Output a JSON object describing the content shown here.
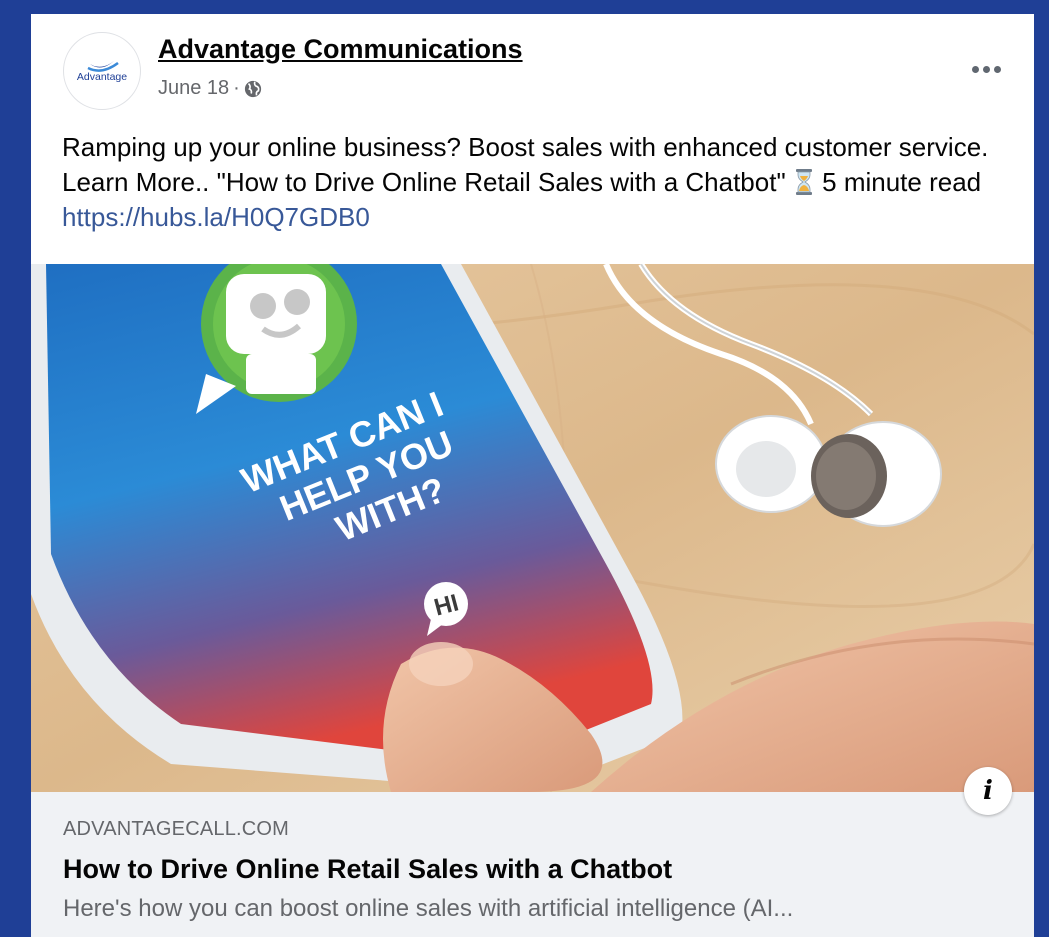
{
  "post": {
    "page_name": "Advantage Communications",
    "date": "June 18",
    "separator": "·",
    "avatar_text": "Advantage",
    "icons": {
      "audience": "globe-icon",
      "more": "more-options-icon",
      "hourglass": "hourglass-icon",
      "info": "info-icon"
    },
    "text_before": "Ramping up your online business? Boost sales with enhanced customer service. Learn More.. \"How to Drive Online Retail Sales with a Chatbot\" ",
    "text_after": " 5 minute read ",
    "link": "https://hubs.la/H0Q7GDB0"
  },
  "image": {
    "bubble_line1": "WHAT CAN I",
    "bubble_line2": "HELP YOU",
    "bubble_line3": "WITH?",
    "hi_text": "HI"
  },
  "preview": {
    "domain": "ADVANTAGECALL.COM",
    "title": "How to Drive Online Retail Sales with a Chatbot",
    "description": "Here's how you can boost online sales with artificial intelligence (AI..."
  },
  "colors": {
    "background": "#1f3f96",
    "link": "#385898",
    "preview_bg": "#f0f2f5"
  }
}
